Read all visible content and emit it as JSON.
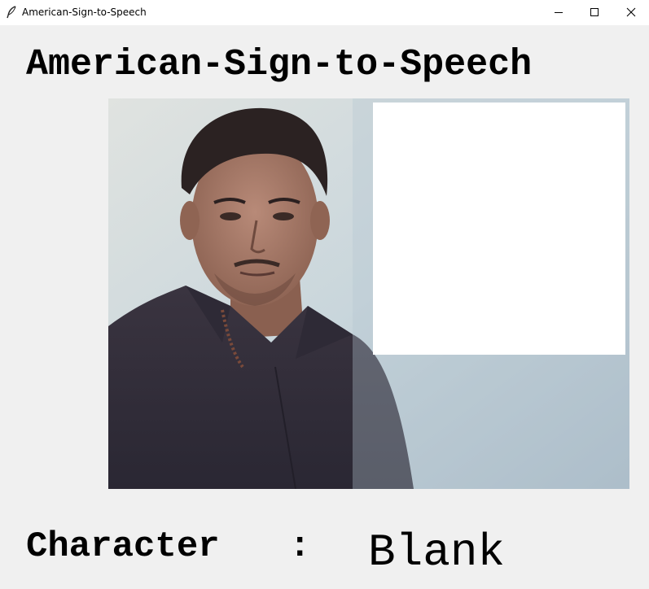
{
  "window": {
    "title": "American-Sign-to-Speech",
    "icon": "feather-icon",
    "controls": [
      "minimize-icon",
      "maximize-icon",
      "close-icon"
    ]
  },
  "main": {
    "heading": "American-Sign-to-Speech",
    "character_label": "Character",
    "separator": ":",
    "character_value": "Blank"
  }
}
